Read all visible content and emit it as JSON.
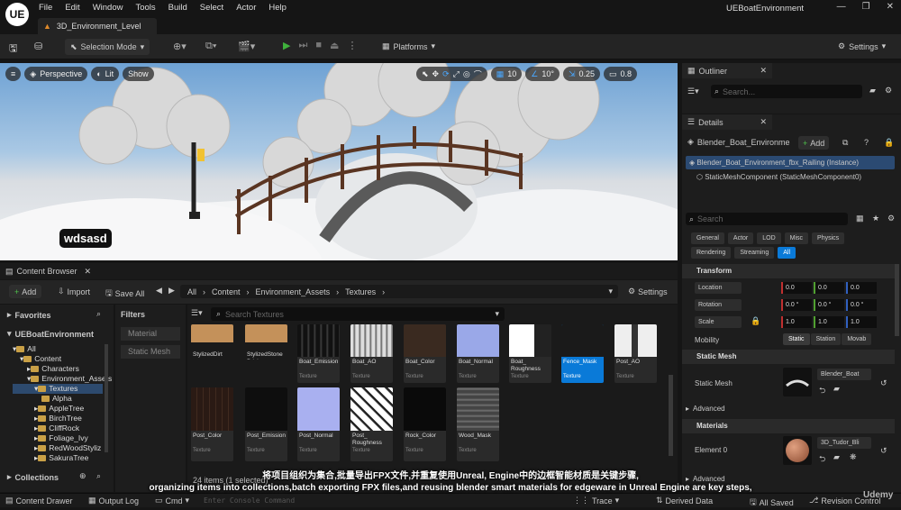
{
  "app": {
    "title": "UEBoatEnvironment",
    "logo": "UE"
  },
  "menu": [
    "File",
    "Edit",
    "Window",
    "Tools",
    "Build",
    "Select",
    "Actor",
    "Help"
  ],
  "level_tab": "3D_Environment_Level",
  "toolbar": {
    "selection_mode": "Selection Mode",
    "platforms": "Platforms",
    "settings": "Settings"
  },
  "viewport": {
    "perspective": "Perspective",
    "lit": "Lit",
    "show": "Show",
    "grid_snap": "10",
    "rot_snap": "10°",
    "scale_snap": "0.25",
    "cam_speed": "0.8",
    "watermark": "wdsasd"
  },
  "content_browser": {
    "tab": "Content Browser",
    "add": "Add",
    "import": "Import",
    "save_all": "Save All",
    "path": [
      "All",
      "Content",
      "Environment_Assets",
      "Textures"
    ],
    "settings": "Settings",
    "favorites": "Favorites",
    "project": "UEBoatEnvironment",
    "tree": [
      "All",
      "Content",
      "Characters",
      "Environment_Assets",
      "Textures",
      "Alpha",
      "AppleTree",
      "BirchTree",
      "CliffRock",
      "Foliage_Ivy",
      "RedWoodStyliz",
      "SakuraTree"
    ],
    "collections": "Collections",
    "filters": "Filters",
    "filter_items": [
      "Material",
      "Static Mesh"
    ],
    "search_placeholder": "Search Textures",
    "assets_row1": [
      {
        "name": "StylizedDirt",
        "type": ""
      },
      {
        "name": "StylizedStone Brick",
        "type": ""
      },
      {
        "name": "Boat_Emission",
        "type": "Texture"
      },
      {
        "name": "Boat_AO",
        "type": "Texture"
      },
      {
        "name": "Boat_Color",
        "type": "Texture"
      },
      {
        "name": "Boat_Normal",
        "type": "Texture"
      },
      {
        "name": "Boat_ Roughness",
        "type": "Texture"
      },
      {
        "name": "Fence_Mask",
        "type": "Texture"
      },
      {
        "name": "Post_AO",
        "type": "Texture"
      }
    ],
    "assets_row2": [
      {
        "name": "Post_Color",
        "type": "Texture"
      },
      {
        "name": "Post_Emission",
        "type": "Texture"
      },
      {
        "name": "Post_Normal",
        "type": "Texture"
      },
      {
        "name": "Post_ Roughness",
        "type": "Texture"
      },
      {
        "name": "Rock_Color",
        "type": "Texture"
      },
      {
        "name": "Wood_Mask",
        "type": "Texture"
      }
    ],
    "item_count": "24 items (1 selected)"
  },
  "outliner": {
    "title": "Outliner",
    "search": "Search..."
  },
  "details": {
    "title": "Details",
    "actor": "Blender_Boat_Environme",
    "add": "Add",
    "instance": "Blender_Boat_Environment_fbx_Railing (Instance)",
    "component": "StaticMeshComponent (StaticMeshComponent0)",
    "search": "Search",
    "tabs_row1": [
      "General",
      "Actor",
      "LOD",
      "Misc",
      "Physics"
    ],
    "tabs_row2": [
      "Rendering",
      "Streaming",
      "All"
    ],
    "transform": "Transform",
    "location": {
      "label": "Location",
      "x": "0.0",
      "y": "0.0",
      "z": "0.0"
    },
    "rotation": {
      "label": "Rotation",
      "x": "0.0 °",
      "y": "0.0 °",
      "z": "0.0 °"
    },
    "scale": {
      "label": "Scale",
      "x": "1.0",
      "y": "1.0",
      "z": "1.0"
    },
    "mobility": {
      "label": "Mobility",
      "options": [
        "Static",
        "Station",
        "Movab"
      ]
    },
    "static_mesh_section": "Static Mesh",
    "static_mesh_label": "Static Mesh",
    "static_mesh_value": "Blender_Boat",
    "advanced": "Advanced",
    "materials_section": "Materials",
    "element0": "Element 0",
    "material_value": "3D_Tudor_Bli",
    "advanced2": "Advanced"
  },
  "status": {
    "content_drawer": "Content Drawer",
    "output_log": "Output Log",
    "cmd": "Cmd",
    "console_placeholder": "Enter Console Command",
    "trace": "Trace",
    "derived_data": "Derived Data",
    "all_saved": "All Saved",
    "revision_control": "Revision Control"
  },
  "subtitles": {
    "cn": "将项目组织为集合,批量导出FPX文件,并重复使用Unreal, Engine中的边框智能材质是关键步骤,",
    "en": "organizing items into collections,batch exporting FPX files,and reusing blender smart materials for edgeware in Unreal Engine are key steps,"
  },
  "udemy": "Udemy",
  "colors": {
    "accent": "#0a7ad8",
    "green": "#38a23a",
    "selected": "#1f5fa8"
  }
}
